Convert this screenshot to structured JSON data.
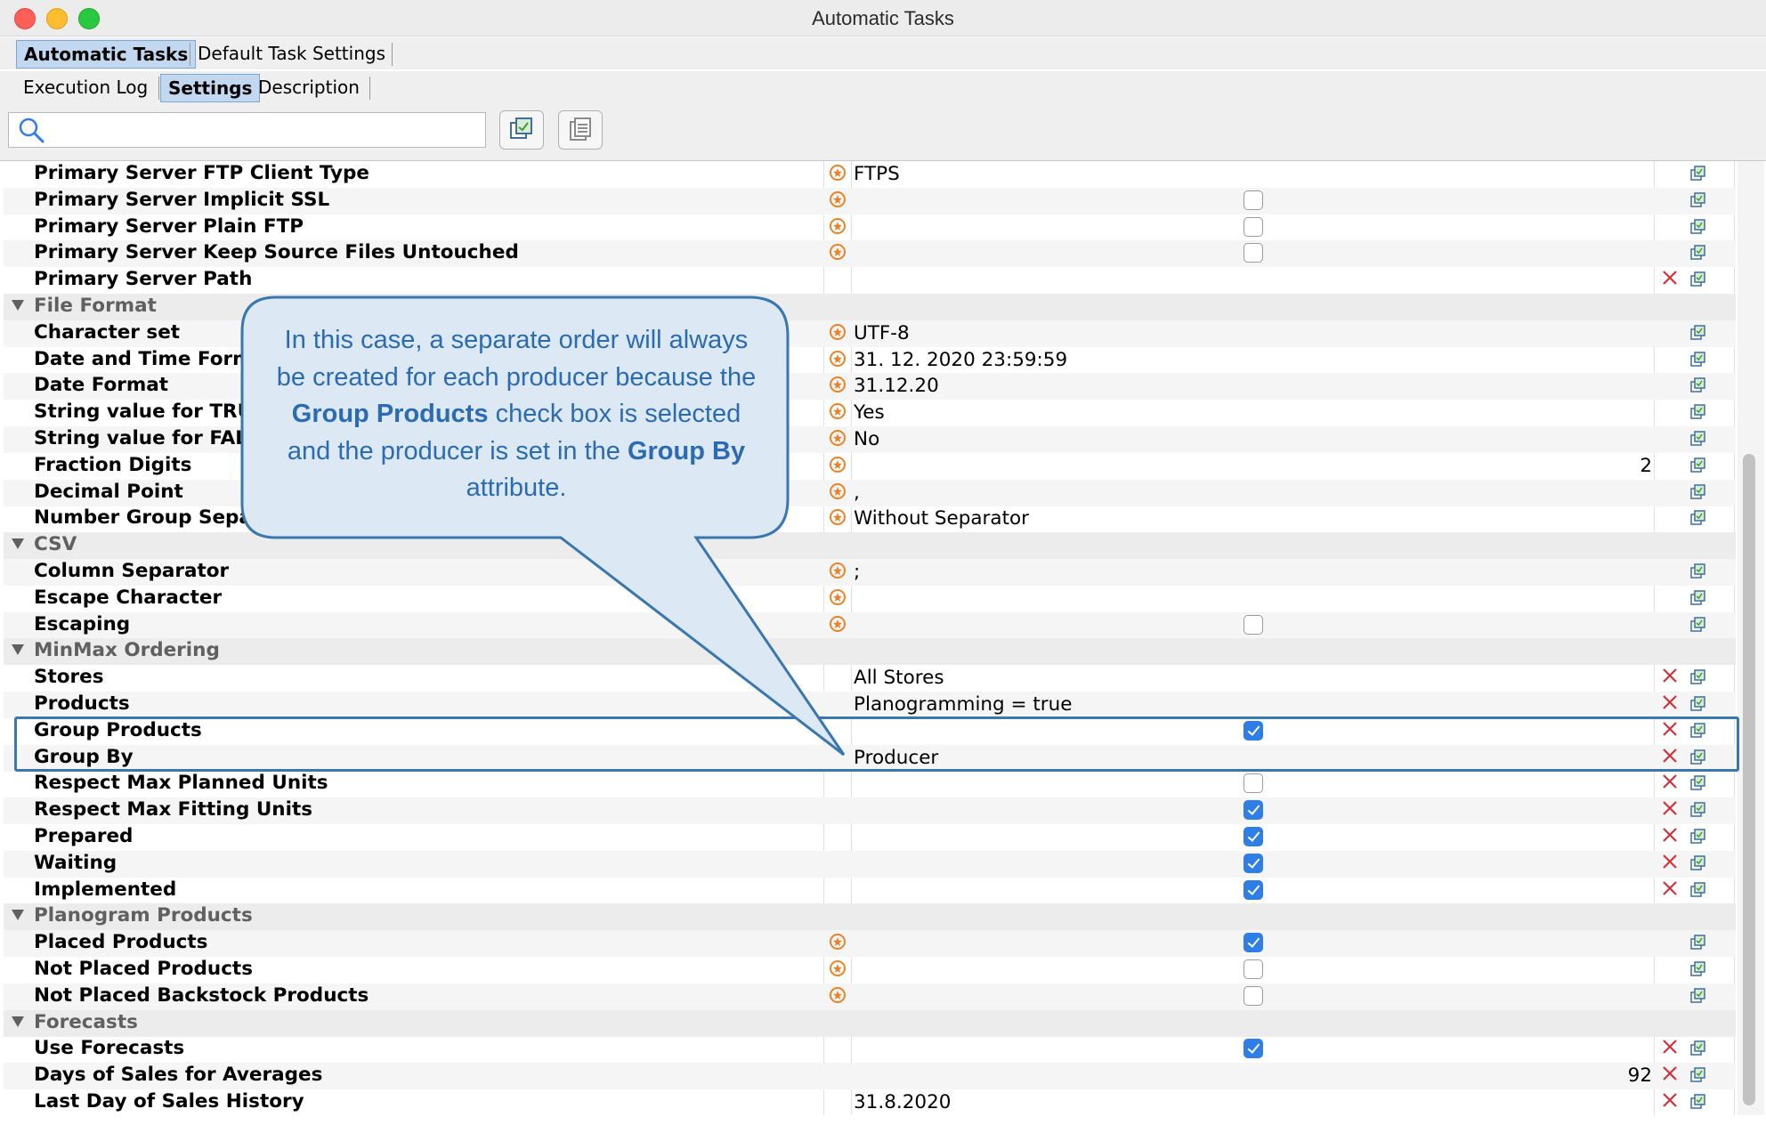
{
  "window": {
    "title": "Automatic Tasks"
  },
  "main_tabs": [
    {
      "label": "Automatic Tasks",
      "selected": true
    },
    {
      "label": "Default Task Settings",
      "selected": false
    }
  ],
  "sub_tabs": [
    {
      "label": "Execution Log",
      "selected": false
    },
    {
      "label": "Settings",
      "selected": true
    },
    {
      "label": "Description",
      "selected": false
    }
  ],
  "search": {
    "placeholder": ""
  },
  "rows": [
    {
      "name": "Primary Server FTP Client Type",
      "value": "FTPS",
      "default_icon": true,
      "copy": true
    },
    {
      "name": "Primary Server Implicit SSL",
      "checkbox": false,
      "default_icon": true,
      "copy": true
    },
    {
      "name": "Primary Server Plain FTP",
      "checkbox": false,
      "default_icon": true,
      "copy": true
    },
    {
      "name": "Primary Server Keep Source Files Untouched",
      "checkbox": false,
      "default_icon": true,
      "copy": true
    },
    {
      "name": "Primary Server Path",
      "remove": true,
      "copy": true
    },
    {
      "group": "File Format"
    },
    {
      "name": "Character set",
      "value": "UTF-8",
      "default_icon": true,
      "copy": true
    },
    {
      "name": "Date and Time Form",
      "value": "31. 12. 2020 23:59:59",
      "default_icon": true,
      "copy": true
    },
    {
      "name": "Date Format",
      "value": "31.12.20",
      "default_icon": true,
      "copy": true
    },
    {
      "name": "String value for TRU",
      "value": "Yes",
      "default_icon": true,
      "copy": true
    },
    {
      "name": "String value for FALS",
      "value": "No",
      "default_icon": true,
      "copy": true
    },
    {
      "name": "Fraction Digits",
      "number": "2",
      "default_icon": true,
      "copy": true
    },
    {
      "name": "Decimal Point",
      "value": ",",
      "default_icon": true,
      "copy": true
    },
    {
      "name": "Number Group Separ",
      "value": "Without Separator",
      "default_icon": true,
      "copy": true
    },
    {
      "group": "CSV"
    },
    {
      "name": "Column Separator",
      "value": ";",
      "default_icon": true,
      "copy": true
    },
    {
      "name": "Escape Character",
      "default_icon": true,
      "copy": true
    },
    {
      "name": "Escaping",
      "checkbox": false,
      "default_icon": true,
      "copy": true
    },
    {
      "group": "MinMax Ordering"
    },
    {
      "name": "Stores",
      "value": "All Stores",
      "remove": true,
      "copy": true
    },
    {
      "name": "Products",
      "value": "Planogramming = true",
      "remove": true,
      "copy": true
    },
    {
      "name": "Group Products",
      "checkbox": true,
      "remove": true,
      "copy": true
    },
    {
      "name": "Group By",
      "value": "Producer",
      "remove": true,
      "copy": true
    },
    {
      "name": "Respect Max Planned Units",
      "checkbox": false,
      "remove": true,
      "copy": true
    },
    {
      "name": "Respect Max Fitting Units",
      "checkbox": true,
      "remove": true,
      "copy": true
    },
    {
      "name": "Prepared",
      "checkbox": true,
      "remove": true,
      "copy": true
    },
    {
      "name": "Waiting",
      "checkbox": true,
      "remove": true,
      "copy": true
    },
    {
      "name": "Implemented",
      "checkbox": true,
      "remove": true,
      "copy": true
    },
    {
      "group": "Planogram Products"
    },
    {
      "name": "Placed Products",
      "checkbox": true,
      "default_icon": true,
      "copy": true
    },
    {
      "name": "Not Placed Products",
      "checkbox": false,
      "default_icon": true,
      "copy": true
    },
    {
      "name": "Not Placed Backstock Products",
      "checkbox": false,
      "default_icon": true,
      "copy": true
    },
    {
      "group": "Forecasts"
    },
    {
      "name": "Use Forecasts",
      "checkbox": true,
      "remove": true,
      "copy": true
    },
    {
      "name": "Days of Sales for Averages",
      "number": "92",
      "remove": true,
      "copy": true
    },
    {
      "name": "Last Day of Sales History",
      "value": "31.8.2020",
      "remove": true,
      "copy": true
    }
  ],
  "callout": {
    "part1": "In this case, a separate order will always be created for each producer because the ",
    "bold1": "Group Products",
    "part2": " check box is selected and the producer is set in the ",
    "bold2": "Group By",
    "part3": " attribute."
  },
  "colors": {
    "accent": "#3a77ae",
    "callout_text": "#2b6bb2",
    "remove": "#d0323a",
    "default_icon": "#e8832a",
    "checkbox_on": "#2f7ee6"
  }
}
